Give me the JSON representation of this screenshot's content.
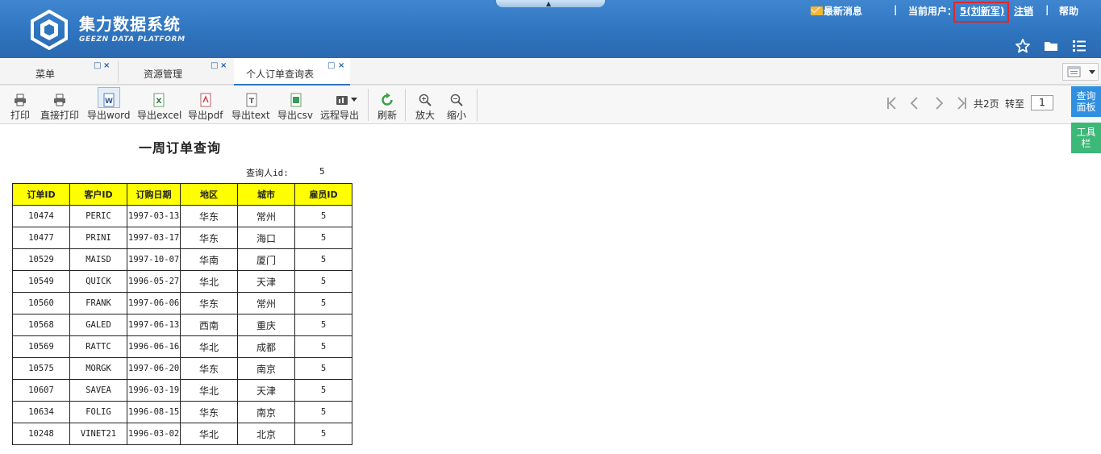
{
  "header": {
    "logo_title": "集力数据系统",
    "logo_subtitle": "GEEZN DATA PLATFORM",
    "latest_message": "最新消息",
    "separator": "|",
    "current_user_label": "当前用户：",
    "current_user": "5(刘新军)",
    "logout": "注销",
    "help": "帮助",
    "icons": [
      "star-icon",
      "folder-icon",
      "list-menu-icon"
    ]
  },
  "tabs": [
    {
      "label": "菜单",
      "active": false
    },
    {
      "label": "资源管理",
      "active": false
    },
    {
      "label": "个人订单查询表",
      "active": true
    }
  ],
  "tab_buttons": {
    "restore": "□",
    "close": "×"
  },
  "toolbar": {
    "items": [
      {
        "label": "打印",
        "icon": "printer-icon"
      },
      {
        "label": "直接打印",
        "icon": "direct-print-icon"
      },
      {
        "label": "导出word",
        "icon": "word-icon"
      },
      {
        "label": "导出excel",
        "icon": "excel-icon"
      },
      {
        "label": "导出pdf",
        "icon": "pdf-icon"
      },
      {
        "label": "导出text",
        "icon": "text-icon"
      },
      {
        "label": "导出csv",
        "icon": "csv-icon"
      },
      {
        "label": "远程导出",
        "icon": "remote-export-icon"
      },
      {
        "label": "刷新",
        "icon": "refresh-icon"
      },
      {
        "label": "放大",
        "icon": "zoom-in-icon"
      },
      {
        "label": "缩小",
        "icon": "zoom-out-icon"
      }
    ]
  },
  "pager": {
    "first": "|<",
    "prev": "<",
    "next": ">",
    "last": ">|",
    "total_pages": "共2页",
    "goto_label": "转至",
    "page_value": "1"
  },
  "side": {
    "query_panel": "查询面板",
    "tools_panel": "工具栏"
  },
  "report": {
    "title": "一周订单查询",
    "param_label": "查询人id:",
    "param_value": "5",
    "columns": [
      "订单ID",
      "客户ID",
      "订购日期",
      "地区",
      "城市",
      "雇员ID"
    ],
    "rows": [
      [
        "10474",
        "PERIC",
        "1997-03-13",
        "华东",
        "常州",
        "5"
      ],
      [
        "10477",
        "PRINI",
        "1997-03-17",
        "华东",
        "海口",
        "5"
      ],
      [
        "10529",
        "MAISD",
        "1997-10-07",
        "华南",
        "厦门",
        "5"
      ],
      [
        "10549",
        "QUICK",
        "1996-05-27",
        "华北",
        "天津",
        "5"
      ],
      [
        "10560",
        "FRANK",
        "1997-06-06",
        "华东",
        "常州",
        "5"
      ],
      [
        "10568",
        "GALED",
        "1997-06-13",
        "西南",
        "重庆",
        "5"
      ],
      [
        "10569",
        "RATTC",
        "1996-06-16",
        "华北",
        "成都",
        "5"
      ],
      [
        "10575",
        "MORGK",
        "1997-06-20",
        "华东",
        "南京",
        "5"
      ],
      [
        "10607",
        "SAVEA",
        "1996-03-19",
        "华北",
        "天津",
        "5"
      ],
      [
        "10634",
        "FOLIG",
        "1996-08-15",
        "华东",
        "南京",
        "5"
      ],
      [
        "10248",
        "VINET21",
        "1996-03-02",
        "华北",
        "北京",
        "5"
      ]
    ]
  },
  "colors": {
    "header_blue": "#2f74bf",
    "table_header_yellow": "#ffff00",
    "highlight_red": "#e0272b",
    "query_panel_blue": "#2f8fe0",
    "tools_panel_green": "#3cb878"
  }
}
